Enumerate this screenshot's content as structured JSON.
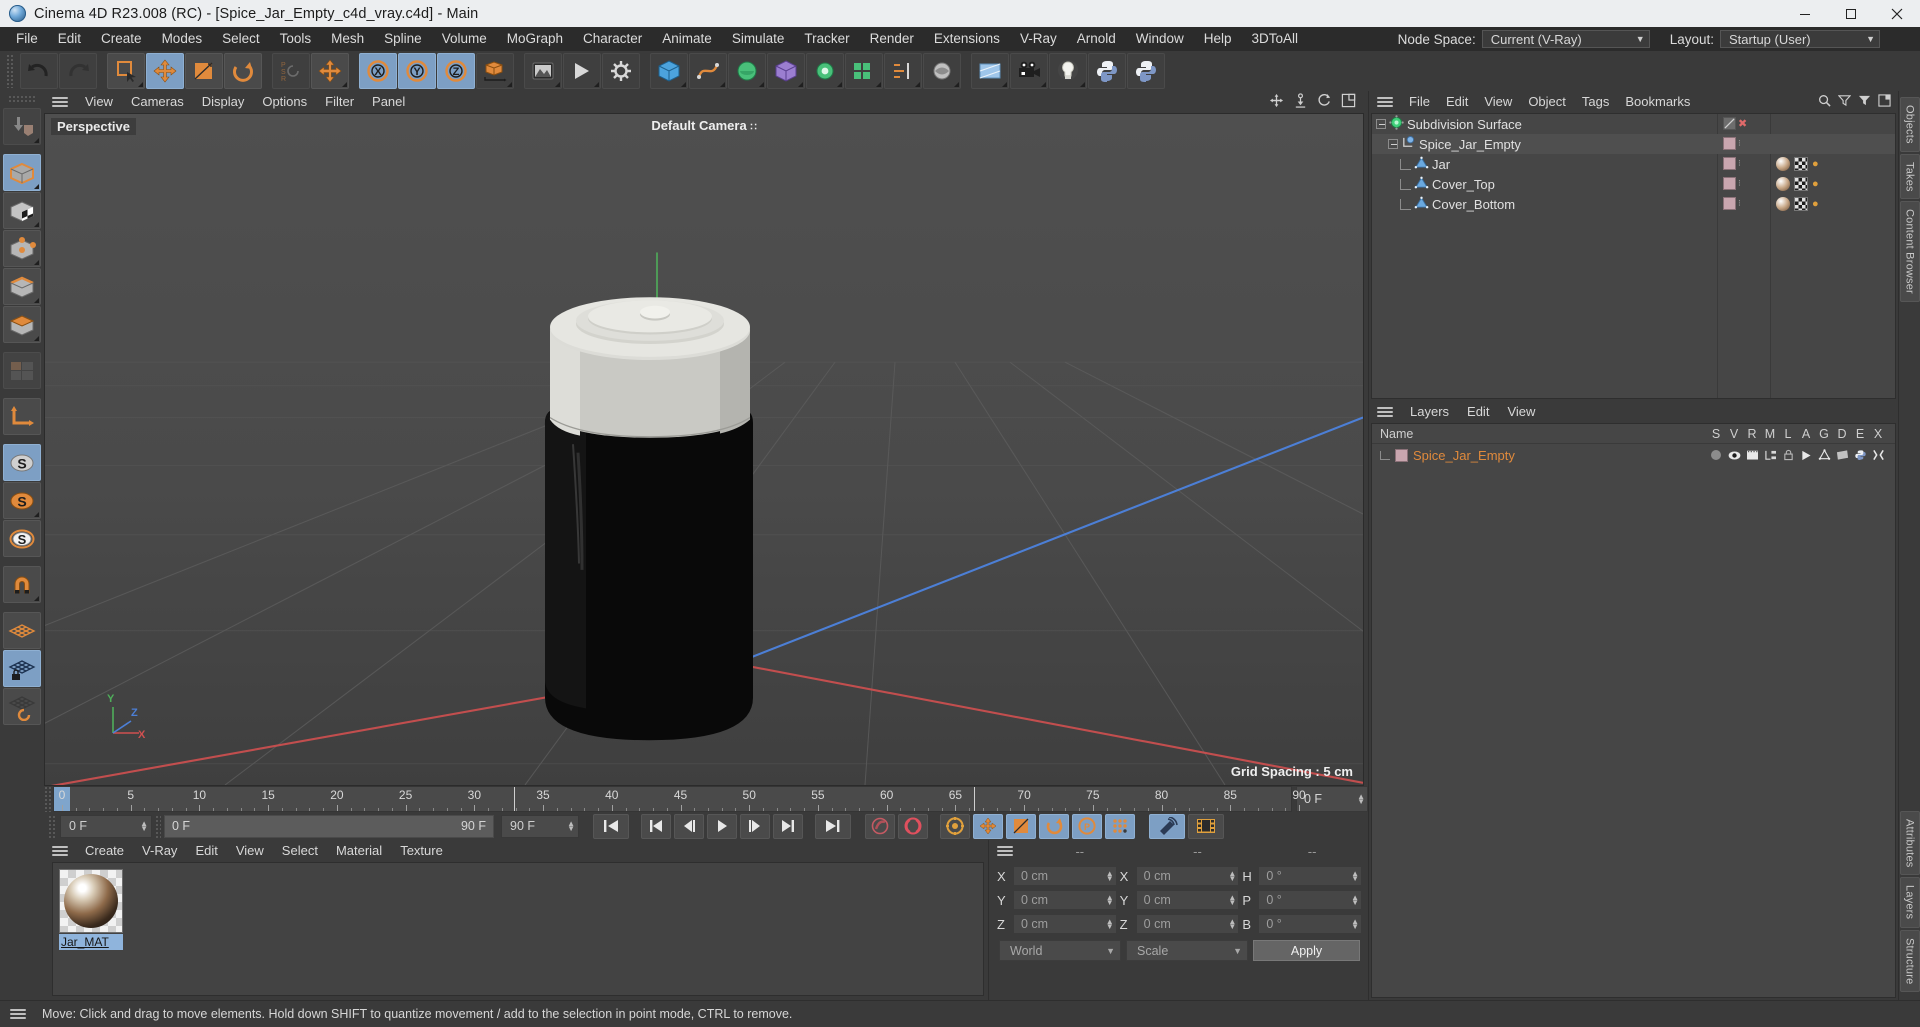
{
  "window": {
    "title": "Cinema 4D R23.008 (RC) - [Spice_Jar_Empty_c4d_vray.c4d] - Main",
    "app_icon": "cinema4d-logo-icon",
    "minimize": "minimize-icon",
    "maximize": "maximize-icon",
    "close": "close-icon"
  },
  "menubar": {
    "items": [
      "File",
      "Edit",
      "Create",
      "Modes",
      "Select",
      "Tools",
      "Mesh",
      "Spline",
      "Volume",
      "MoGraph",
      "Character",
      "Animate",
      "Simulate",
      "Tracker",
      "Render",
      "Extensions",
      "V-Ray",
      "Arnold",
      "Window",
      "Help",
      "3DToAll"
    ],
    "node_space_label": "Node Space:",
    "node_space_value": "Current (V-Ray)",
    "layout_label": "Layout:",
    "layout_value": "Startup (User)"
  },
  "toolbar": {
    "icons": [
      "undo-icon",
      "redo-icon",
      "live-selection-icon",
      "move-icon",
      "scale-icon",
      "rotate-icon",
      "psr-reset-icon",
      "move-duplicate-icon",
      "x-axis-lock-icon",
      "y-axis-lock-icon",
      "z-axis-lock-icon",
      "world-object-axis-icon",
      "cube-primitive-icon",
      "spline-pen-icon",
      "generator-icon",
      "deformer-icon",
      "scene-icon",
      "mograph-icon",
      "array-icon",
      "deformation-icon",
      "render-view-icon",
      "render-picture-viewer-icon",
      "render-settings-icon",
      "environment-icon",
      "camera-icon",
      "light-icon",
      "python-generator-icon",
      "python-tag-icon"
    ]
  },
  "left_toolbar": {
    "icons": [
      "make-editable-icon",
      "model-mode-icon",
      "texture-mode-icon",
      "points-mode-icon",
      "edges-mode-icon",
      "polygons-mode-icon",
      "uv-mode-icon",
      "workplane-icon",
      "enable-axis-icon",
      "enable-snap-s-icon",
      "object-axis-icon",
      "snap-magnet-icon",
      "workplane-grid-icon",
      "lock-workplane-icon",
      "planar-workplane-icon"
    ]
  },
  "viewport": {
    "menu": [
      "View",
      "Cameras",
      "Display",
      "Options",
      "Filter",
      "Panel"
    ],
    "label": "Perspective",
    "camera_label": "Default Camera",
    "grid_spacing": "Grid Spacing : 5 cm",
    "corner_icons": [
      "pan-view-icon",
      "dolly-view-icon",
      "rotate-view-icon",
      "maximize-view-icon"
    ],
    "axis_x": "X",
    "axis_y": "Y",
    "axis_z": "Z"
  },
  "timeline": {
    "ticks": [
      "0",
      "5",
      "10",
      "15",
      "20",
      "25",
      "30",
      "35",
      "40",
      "45",
      "50",
      "55",
      "60",
      "65",
      "70",
      "75",
      "80",
      "85",
      "90"
    ],
    "current_frame_right": "0 F",
    "start_field": "0 F",
    "range_start": "0 F",
    "range_end": "90 F",
    "end_field": "90 F",
    "transport_icons": [
      "go-to-start-icon",
      "go-to-previous-key-icon",
      "step-back-icon",
      "play-icon",
      "step-forward-icon",
      "go-to-next-key-icon",
      "go-to-end-icon",
      "record-active-objects-icon",
      "autokeying-icon",
      "keyframe-settings-icon",
      "position-key-icon",
      "scale-key-icon",
      "rotation-key-icon",
      "pla-key-icon",
      "parameter-key-icon",
      "simulate-icon",
      "timeline-icon"
    ]
  },
  "materials": {
    "menu": [
      "Create",
      "V-Ray",
      "Edit",
      "View",
      "Select",
      "Material",
      "Texture"
    ],
    "items": [
      {
        "name": "Jar_MAT",
        "selected": true
      }
    ]
  },
  "coordinates": {
    "header": [
      "--",
      "--",
      "--"
    ],
    "rows": [
      {
        "pos_label": "X",
        "pos_value": "0 cm",
        "size_label": "X",
        "size_value": "0 cm",
        "rot_label": "H",
        "rot_value": "0 °"
      },
      {
        "pos_label": "Y",
        "pos_value": "0 cm",
        "size_label": "Y",
        "size_value": "0 cm",
        "rot_label": "P",
        "rot_value": "0 °"
      },
      {
        "pos_label": "Z",
        "pos_value": "0 cm",
        "size_label": "Z",
        "size_value": "0 cm",
        "rot_label": "B",
        "rot_value": "0 °"
      }
    ],
    "system": "World",
    "mode": "Scale",
    "apply": "Apply"
  },
  "object_manager": {
    "menu": [
      "File",
      "Edit",
      "View",
      "Object",
      "Tags",
      "Bookmarks"
    ],
    "icons": [
      "search-icon",
      "filter-up-icon",
      "filter-down-icon",
      "layout-icon"
    ],
    "items": [
      {
        "name": "Subdivision Surface",
        "icon": "subdivision-surface-icon",
        "depth": 0,
        "expander": "open",
        "tags": "visibility-dots"
      },
      {
        "name": "Spice_Jar_Empty",
        "icon": "null-object-icon",
        "depth": 1,
        "expander": "open",
        "tags": "swatch"
      },
      {
        "name": "Jar",
        "icon": "polygon-object-icon",
        "depth": 2,
        "expander": "none",
        "tags": "swatch-material-uv"
      },
      {
        "name": "Cover_Top",
        "icon": "polygon-object-icon",
        "depth": 2,
        "expander": "none",
        "tags": "swatch-material-uv"
      },
      {
        "name": "Cover_Bottom",
        "icon": "polygon-object-icon",
        "depth": 2,
        "expander": "none",
        "tags": "swatch-material-uv"
      }
    ]
  },
  "layers": {
    "menu": [
      "Layers",
      "Edit",
      "View"
    ],
    "columns": [
      "Name",
      "S",
      "V",
      "R",
      "M",
      "L",
      "A",
      "G",
      "D",
      "E",
      "X"
    ],
    "rows": [
      {
        "name": "Spice_Jar_Empty",
        "color": "#e08a3c",
        "swatch": "#c9a6af"
      }
    ]
  },
  "right_tabs": [
    "Objects",
    "Takes",
    "Content Browser",
    "Attributes",
    "Layers",
    "Structure"
  ],
  "status": {
    "text": "Move: Click and drag to move elements. Hold down SHIFT to quantize movement / add to the selection in point mode, CTRL to remove."
  },
  "colors": {
    "panel_bg": "#3a3a3a",
    "field_bg": "#464646",
    "accent_blue": "#7d9fc4",
    "accent_orange": "#e08a3c",
    "viewport_bg": "#4b4b4b",
    "titlebar_bg": "#eceef0"
  }
}
